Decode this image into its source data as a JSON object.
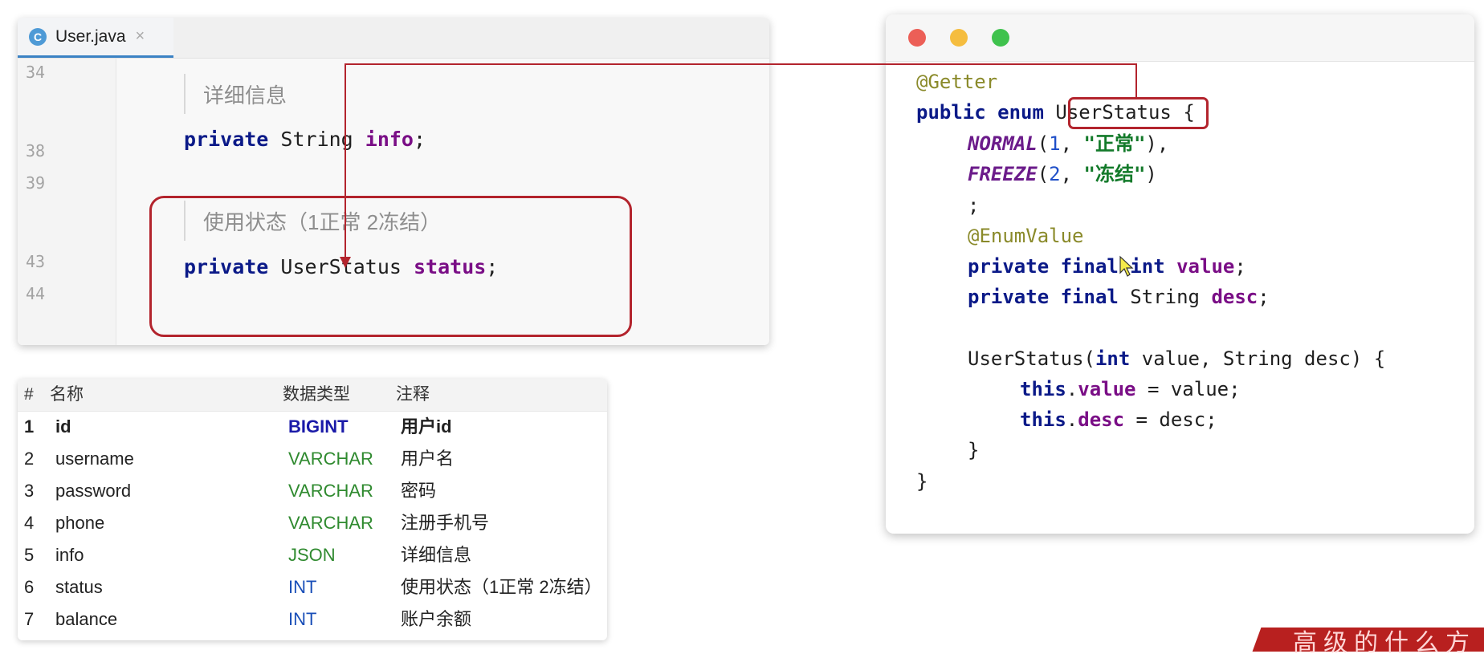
{
  "ide": {
    "tab": {
      "icon_letter": "C",
      "filename": "User.java",
      "close_glyph": "×"
    },
    "line_numbers": [
      "34",
      "38",
      "39",
      "43",
      "44"
    ],
    "comment_info": "详细信息",
    "line_info": {
      "kw": "private",
      "type": " String ",
      "field": "info",
      "end": ";"
    },
    "comment_status": "使用状态（1正常 2冻结）",
    "line_status": {
      "kw": "private",
      "type": " UserStatus ",
      "field": "status",
      "end": ";"
    }
  },
  "db_table": {
    "headers": {
      "num": "#",
      "name": "名称",
      "type": "数据类型",
      "note": "注释"
    },
    "rows": [
      {
        "num": "1",
        "name": "id",
        "type": "BIGINT",
        "note": "用户id"
      },
      {
        "num": "2",
        "name": "username",
        "type": "VARCHAR",
        "note": "用户名"
      },
      {
        "num": "3",
        "name": "password",
        "type": "VARCHAR",
        "note": "密码"
      },
      {
        "num": "4",
        "name": "phone",
        "type": "VARCHAR",
        "note": "注册手机号"
      },
      {
        "num": "5",
        "name": "info",
        "type": "JSON",
        "note": "详细信息"
      },
      {
        "num": "6",
        "name": "status",
        "type": "INT",
        "note": "使用状态（1正常 2冻结）"
      },
      {
        "num": "7",
        "name": "balance",
        "type": "INT",
        "note": "账户余额"
      }
    ],
    "type_colors": {
      "BIGINT": "#1a1aa8",
      "VARCHAR": "#2f8a2f",
      "JSON": "#2f8a2f",
      "INT": "#1a4fb8"
    }
  },
  "code_window": {
    "traffic_lights": {
      "close": "#ec5f57",
      "minimize": "#f5bd3f",
      "maximize": "#3fc24d"
    },
    "getter": "@Getter",
    "decl_kw": "public enum ",
    "enum_name": "UserStatus",
    "decl_brace": " {",
    "normal": {
      "name": "NORMAL",
      "open": "(",
      "num": "1",
      "sep": ", ",
      "str": "\"正常\"",
      "close": "),"
    },
    "freeze": {
      "name": "FREEZE",
      "open": "(",
      "num": "2",
      "sep": ", ",
      "str": "\"冻结\"",
      "close": ")"
    },
    "semicolon": ";",
    "enum_value_ann": "@EnumValue",
    "field_value": {
      "kw": "private final int ",
      "name": "value",
      "end": ";"
    },
    "field_desc": {
      "kw": "private final ",
      "type": "String ",
      "name": "desc",
      "end": ";"
    },
    "ctor": {
      "name": "UserStatus(",
      "kw1": "int",
      "mid": " value, String desc) {"
    },
    "assign_value": {
      "kw": "this",
      "dot": ".",
      "name": "value",
      "rest": " = value;"
    },
    "assign_desc": {
      "kw": "this",
      "dot": ".",
      "name": "desc",
      "rest": " = desc;"
    },
    "close_inner": "}",
    "close_outer": "}"
  },
  "banner": {
    "text": "高级的什么方"
  },
  "colors": {
    "highlight": "#b3242d",
    "arrow": "#b3242d",
    "tab_underline": "#3b82c4"
  }
}
